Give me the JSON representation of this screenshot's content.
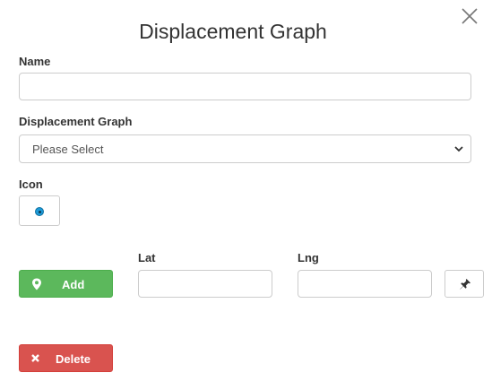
{
  "dialog": {
    "title": "Displacement Graph",
    "close_icon": "close-icon"
  },
  "form": {
    "name_label": "Name",
    "name_value": "",
    "graph_label": "Displacement Graph",
    "graph_selected": "Please Select",
    "icon_label": "Icon",
    "icon_preview": "blue-dot-marker-icon",
    "lat_label": "Lat",
    "lat_value": "",
    "lng_label": "Lng",
    "lng_value": "",
    "pick_location_icon": "pushpin-icon"
  },
  "actions": {
    "add_label": "Add",
    "add_icon": "map-marker-icon",
    "delete_label": "Delete",
    "delete_icon": "x-icon"
  },
  "colors": {
    "add_button": "#5cb85c",
    "delete_button": "#d9534f",
    "marker_dot": "#1e9bd8"
  }
}
